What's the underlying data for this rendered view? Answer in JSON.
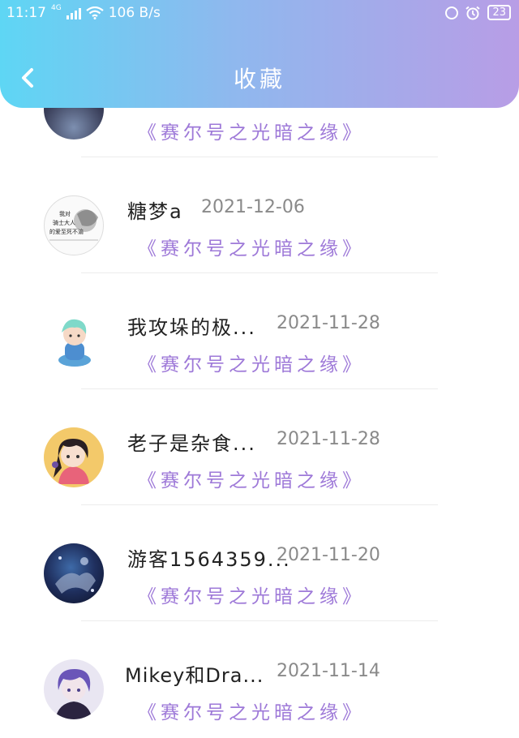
{
  "status_bar": {
    "time": "11:17",
    "network": "4G",
    "speed": "106 B/s",
    "battery": "23"
  },
  "header": {
    "title": "收藏",
    "back_icon": "chevron-left-icon"
  },
  "items": [
    {
      "name": "",
      "date": "",
      "book": "《赛尔号之光暗之缘》"
    },
    {
      "name": "糖梦a",
      "date": "2021-12-06",
      "book": "《赛尔号之光暗之缘》",
      "avatar_text": "我对 骑士大人 的爱至死不渝"
    },
    {
      "name": "我攻垛的极...",
      "date": "2021-11-28",
      "book": "《赛尔号之光暗之缘》"
    },
    {
      "name": "老子是杂食...",
      "date": "2021-11-28",
      "book": "《赛尔号之光暗之缘》"
    },
    {
      "name": "游客1564359...",
      "date": "2021-11-20",
      "book": "《赛尔号之光暗之缘》"
    },
    {
      "name": "Mikey和Dra...",
      "date": "2021-11-14",
      "book": "《赛尔号之光暗之缘》"
    }
  ],
  "colors": {
    "header_start": "#5ed6f4",
    "header_end": "#b89de6",
    "book_title": "#9e79d8",
    "date": "#8a8a8a"
  }
}
